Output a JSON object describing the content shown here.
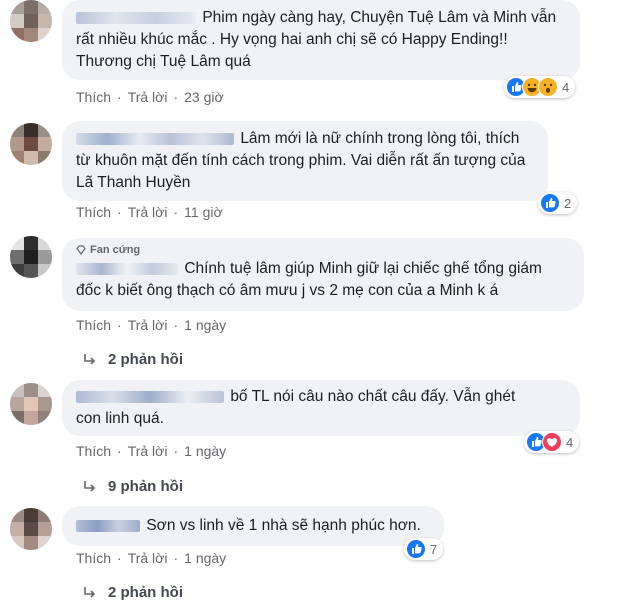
{
  "actions": {
    "like": "Thích",
    "reply": "Trả lời",
    "separator": "·"
  },
  "comments": [
    {
      "author": "Nguyễn Hồng",
      "text": "Phim ngày càng hay, Chuyện Tuệ Lâm và Minh vẫn rất nhiều khúc mắc . Hy vọng hai anh chị sẽ có Happy Ending!! Thương chị Tuệ Lâm quá",
      "time": "23 giờ",
      "reactions": [
        "like",
        "haha",
        "wow"
      ],
      "reaction_count": "4"
    },
    {
      "author": "",
      "text": "Lâm mới là nữ chính trong lòng tôi, thích từ khuôn mặt đến tính cách trong phim. Vai diễn rất ấn tượng của Lã Thanh Huyền",
      "time": "11 giờ",
      "reactions": [
        "like"
      ],
      "reaction_count": "2"
    },
    {
      "author": "",
      "badge": "Fan cứng",
      "text": "Chính tuệ lâm giúp Minh giữ lại chiếc ghế tổng giám đốc k biết ông thạch có âm mưu j vs 2 mẹ con của a Minh k á",
      "time": "1 ngày",
      "replies": "2 phản hồi"
    },
    {
      "author": "",
      "text": "bố TL nói câu nào chất câu đấy. Vẫn ghét con linh quá.",
      "time": "1 ngày",
      "reactions": [
        "like",
        "love"
      ],
      "reaction_count": "4",
      "replies": "9 phản hồi"
    },
    {
      "author": "",
      "text": "Sơn vs linh về 1 nhà sẽ hạnh phúc hơn.",
      "time": "1 ngày",
      "reactions": [
        "like"
      ],
      "reaction_count": "7",
      "replies": "2 phản hồi"
    }
  ],
  "colors": {
    "like": "#1877f2",
    "love": "#f33e58",
    "haha": "#f7b125",
    "bubble": "#f0f2f5"
  }
}
